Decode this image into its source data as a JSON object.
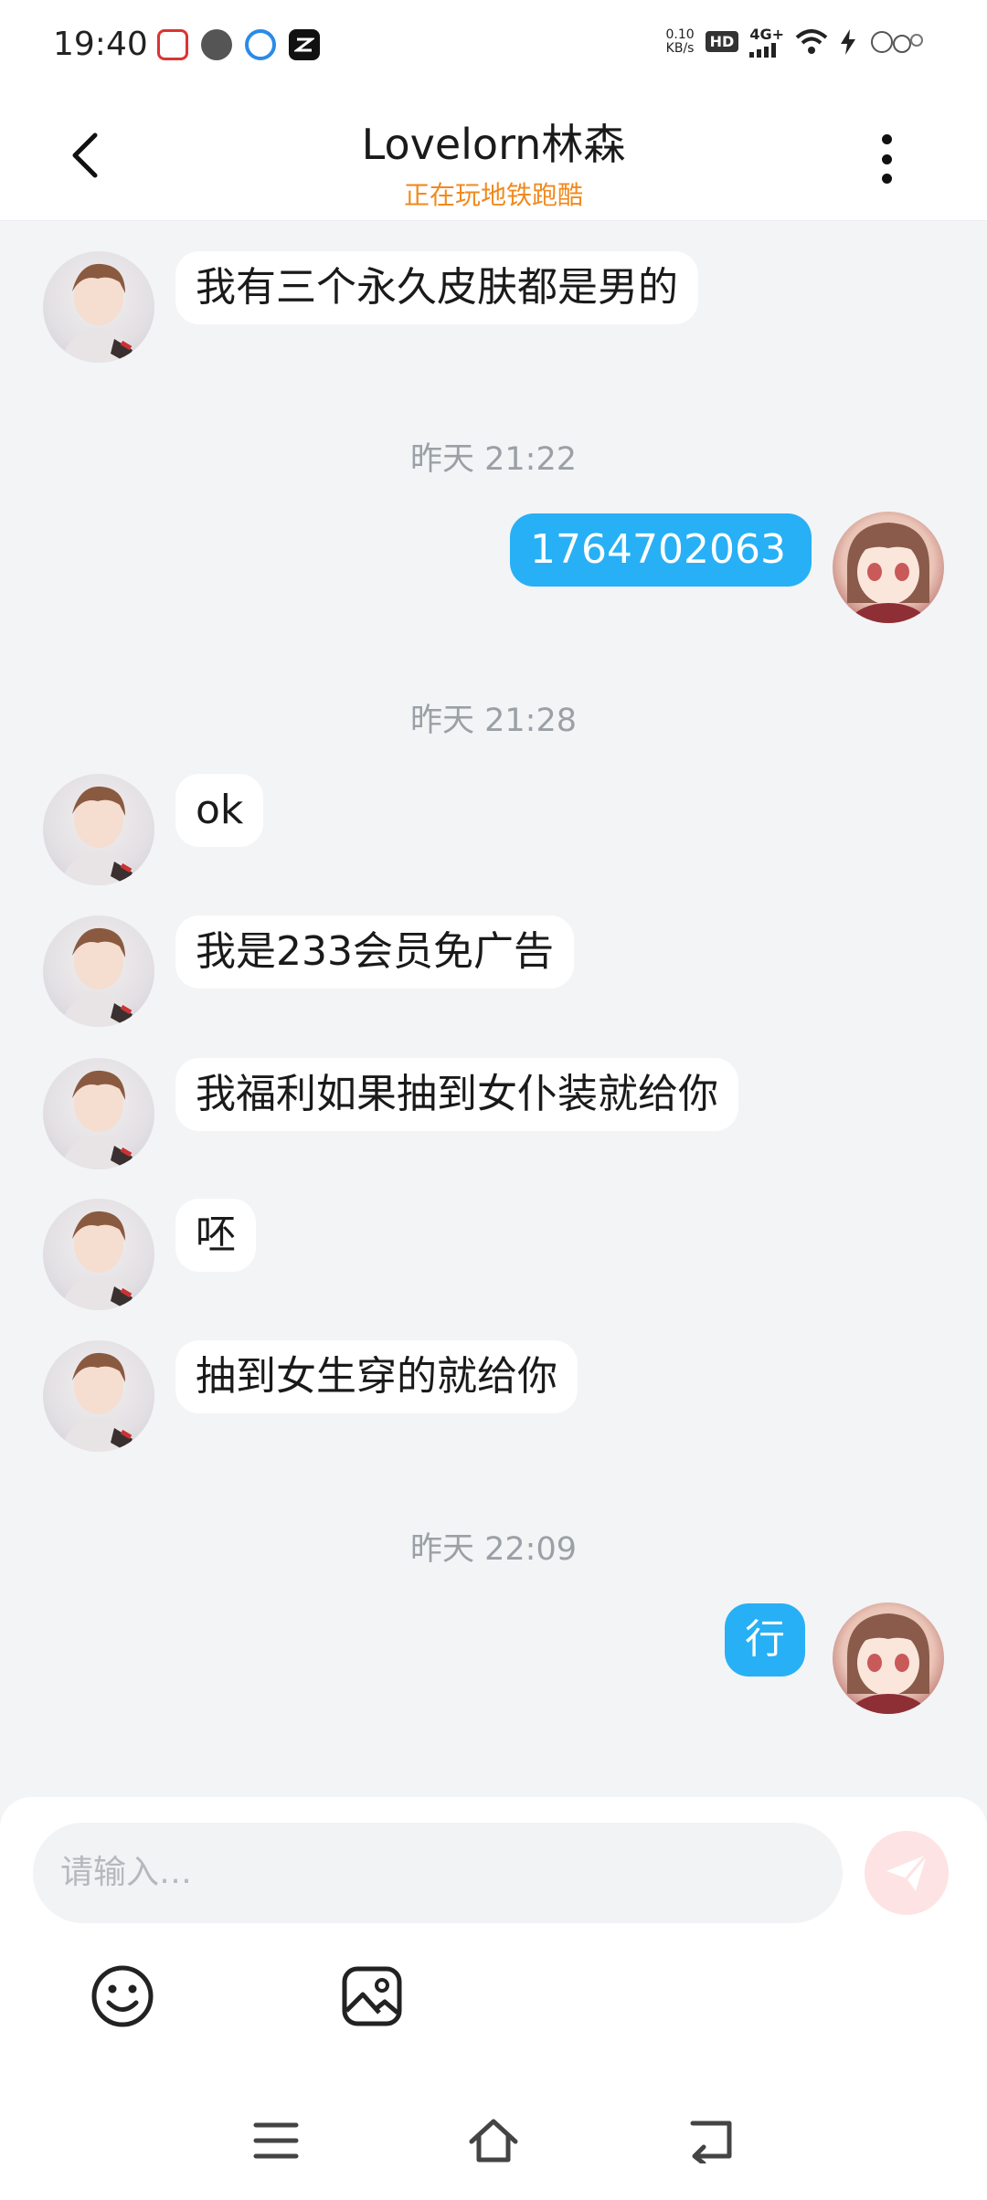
{
  "status_bar": {
    "time": "19:40",
    "net_speed_value": "0.10",
    "net_speed_unit": "KB/s",
    "hd_label": "HD",
    "network_type": "4G+",
    "app_icons": [
      "baidu-icon",
      "clock-icon",
      "browser-icon",
      "capcut-icon"
    ]
  },
  "header": {
    "title": "Lovelorn林森",
    "subtitle": "正在玩地铁跑酷"
  },
  "messages": [
    {
      "type": "message",
      "from": "friend",
      "text": "我有三个永久皮肤都是男的"
    },
    {
      "type": "timestamp",
      "text": "昨天 21:22"
    },
    {
      "type": "message",
      "from": "me",
      "text": "1764702063"
    },
    {
      "type": "timestamp",
      "text": "昨天 21:28"
    },
    {
      "type": "message",
      "from": "friend",
      "text": "ok"
    },
    {
      "type": "message",
      "from": "friend",
      "text": "我是233会员免广告"
    },
    {
      "type": "message",
      "from": "friend",
      "text": "我福利如果抽到女仆装就给你"
    },
    {
      "type": "message",
      "from": "friend",
      "text": "呸"
    },
    {
      "type": "message",
      "from": "friend",
      "text": "抽到女生穿的就给你"
    },
    {
      "type": "timestamp",
      "text": "昨天 22:09"
    },
    {
      "type": "message",
      "from": "me",
      "text": "行"
    }
  ],
  "input": {
    "placeholder": "请输入…"
  },
  "colors": {
    "accent": "#27b0f5",
    "subtitle": "#f08a1e",
    "background": "#f3f4f6",
    "send_button": "#fde3e3"
  }
}
